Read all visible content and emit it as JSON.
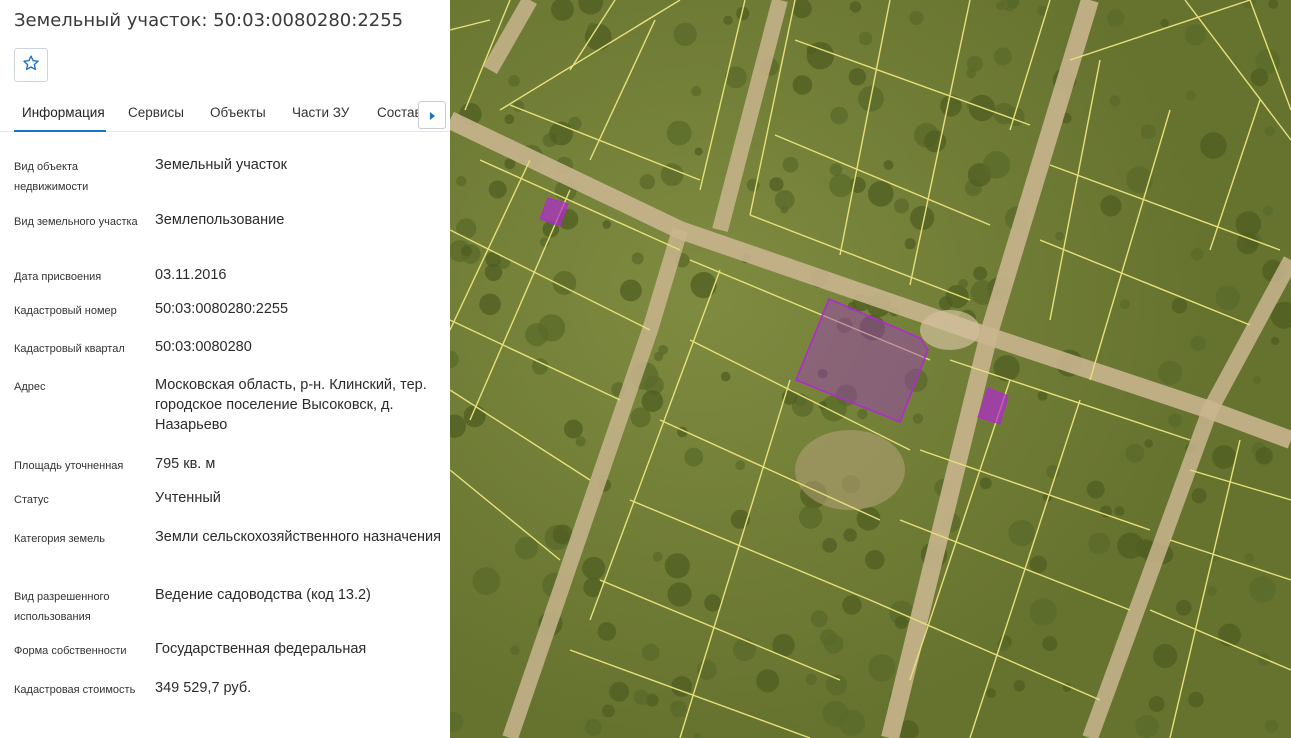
{
  "header": {
    "title": "Земельный участок: 50:03:0080280:2255"
  },
  "icons": {
    "favorite": "star-outline-icon",
    "tabs_next": "chevron-right-icon"
  },
  "tabs": [
    {
      "label": "Информация",
      "active": true
    },
    {
      "label": "Сервисы"
    },
    {
      "label": "Объекты"
    },
    {
      "label": "Части ЗУ"
    },
    {
      "label": "Состав"
    }
  ],
  "info": {
    "rows": [
      {
        "label": "Вид объекта недвижимости",
        "value": "Земельный участок"
      },
      {
        "label": "Вид земельного участка",
        "value": "Землепользование"
      },
      {
        "label": "Дата присвоения",
        "value": "03.11.2016"
      },
      {
        "label": "Кадастровый номер",
        "value": "50:03:0080280:2255"
      },
      {
        "label": "Кадастровый квартал",
        "value": "50:03:0080280"
      },
      {
        "label": "Адрес",
        "value": "Московская область, р-н. Клинский, тер. городское поселение Высоковск, д. Назарьево"
      },
      {
        "label": "Площадь уточненная",
        "value": "795 кв. м"
      },
      {
        "label": "Статус",
        "value": "Учтенный"
      },
      {
        "label": "Категория земель",
        "value": "Земли сельскохозяйственного назначения"
      },
      {
        "label": "Вид разрешенного использования",
        "value": "Ведение садоводства (код 13.2)"
      },
      {
        "label": "Форма собственности",
        "value": "Государственная федеральная"
      },
      {
        "label": "Кадастровая стоимость",
        "value": "349 529,7 руб."
      }
    ]
  },
  "map": {
    "parcel_border_color": "#e7e07a",
    "selected_parcel_color": "#b02ad0",
    "road_color": "#c9b58e"
  }
}
